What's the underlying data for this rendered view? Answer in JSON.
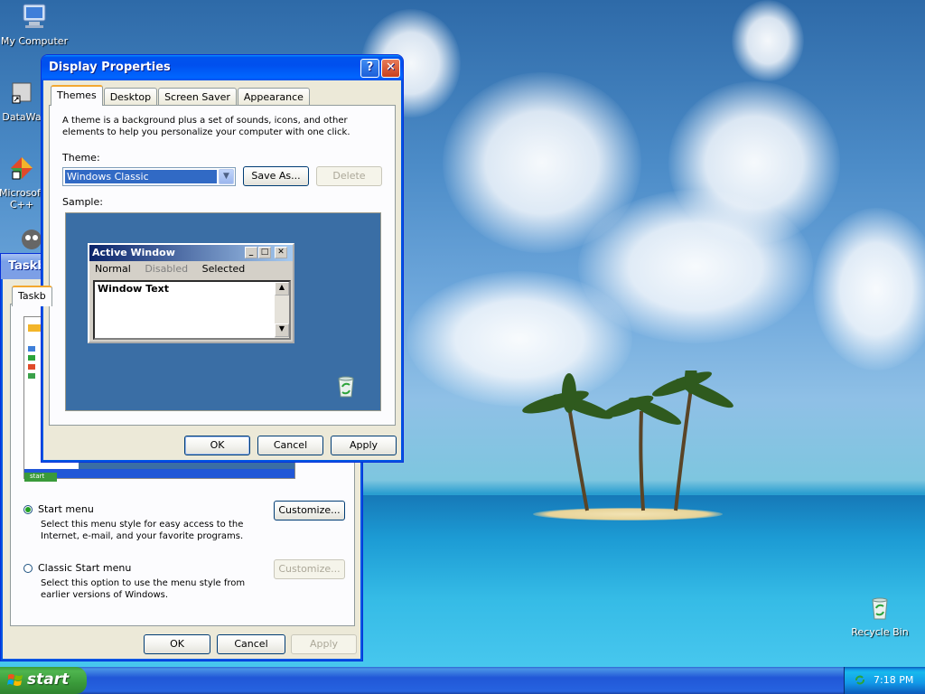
{
  "desktop": {
    "icons": [
      {
        "label": "My Computer"
      },
      {
        "label": "DataWa"
      },
      {
        "label": "Microsoft C++"
      },
      {
        "label": "Recycle Bin"
      }
    ]
  },
  "display_properties": {
    "title": "Display Properties",
    "help_glyph": "?",
    "close_glyph": "✕",
    "tabs": [
      "Themes",
      "Desktop",
      "Screen Saver",
      "Appearance"
    ],
    "description": "A theme is a background plus a set of sounds, icons, and other elements to help you personalize your computer with one click.",
    "theme_label": "Theme:",
    "theme_value": "Windows Classic",
    "save_as_label": "Save As...",
    "delete_label": "Delete",
    "sample_label": "Sample:",
    "sample": {
      "window_title": "Active Window",
      "menu": [
        "Normal",
        "Disabled",
        "Selected"
      ],
      "window_text": "Window Text"
    },
    "ok_label": "OK",
    "cancel_label": "Cancel",
    "apply_label": "Apply"
  },
  "taskbar_properties": {
    "title": "Taskb",
    "tab": "Taskb",
    "start_menu_label": "Start menu",
    "start_menu_desc": "Select this menu style for easy access to the Internet, e-mail, and your favorite programs.",
    "classic_label": "Classic Start menu",
    "classic_desc": "Select this option to use the menu style from earlier versions of Windows.",
    "customize_label": "Customize...",
    "ok_label": "OK",
    "cancel_label": "Cancel",
    "apply_label": "Apply",
    "preview_start": "start"
  },
  "taskbar": {
    "start_label": "start",
    "clock": "7:18 PM"
  }
}
